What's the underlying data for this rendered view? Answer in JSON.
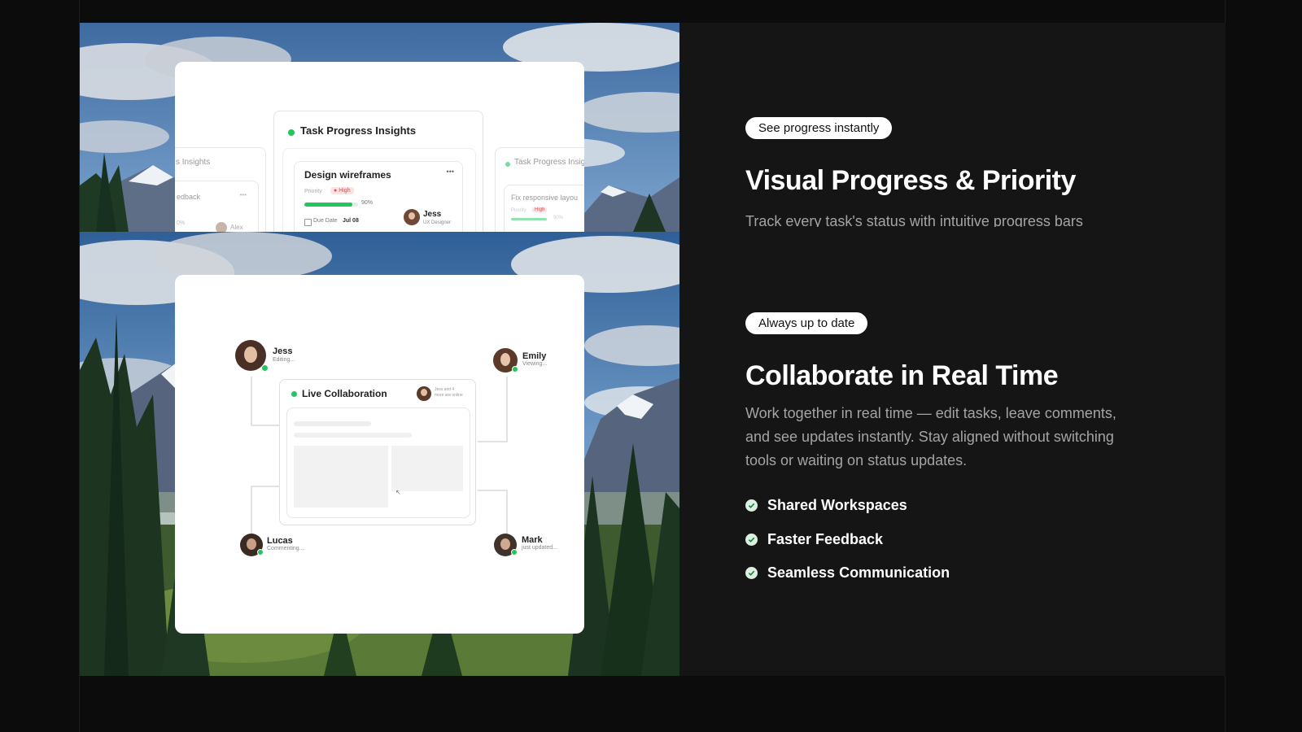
{
  "colors": {
    "page_bg": "#0c0c0c",
    "section_bg": "#151515",
    "accent_green": "#22c55e",
    "priority_red": "#e5484d"
  },
  "features_panel_1": {
    "badge": "See progress instantly",
    "title": "Visual Progress & Priority",
    "description": "Track every task's status with intuitive progress bars"
  },
  "features_panel_2": {
    "badge": "Always up to date",
    "title": "Collaborate in Real Time",
    "description": "Work together in real time — edit tasks, leave comments, and see updates instantly. Stay aligned without switching tools or waiting on status updates.",
    "bullets": [
      "Shared Workspaces",
      "Faster Feedback",
      "Seamless Communication"
    ]
  },
  "progress_card": {
    "title": "Task Progress Insights",
    "left_ghost_title": "s Insights",
    "left_ghost_item": "edback",
    "left_ghost_person": "Alex",
    "left_ghost_percent": "0%",
    "right_ghost_title": "Task Progress Insigh",
    "right_ghost_item": "Fix responsive layou",
    "right_ghost_priority": "Priority",
    "right_ghost_badge": "High",
    "right_ghost_percent": "90%",
    "task": {
      "name": "Design wireframes",
      "priority_label": "Priority",
      "priority_value": "High",
      "progress": 0.9,
      "progress_text": "90%",
      "due_label": "Due Date",
      "due_value": "Jul 08",
      "assignee": "Jess",
      "assignee_role": "UX Designer",
      "menu": "•••"
    }
  },
  "collab_card": {
    "center_title": "Live Collaboration",
    "online_text_1": "Jess and 4",
    "online_text_2": "more are online",
    "users": [
      {
        "name": "Jess",
        "status": "Editing..."
      },
      {
        "name": "Emily",
        "status": "Viewing..."
      },
      {
        "name": "Lucas",
        "status": "Commenting..."
      },
      {
        "name": "Mark",
        "status": "just updated..."
      }
    ]
  }
}
